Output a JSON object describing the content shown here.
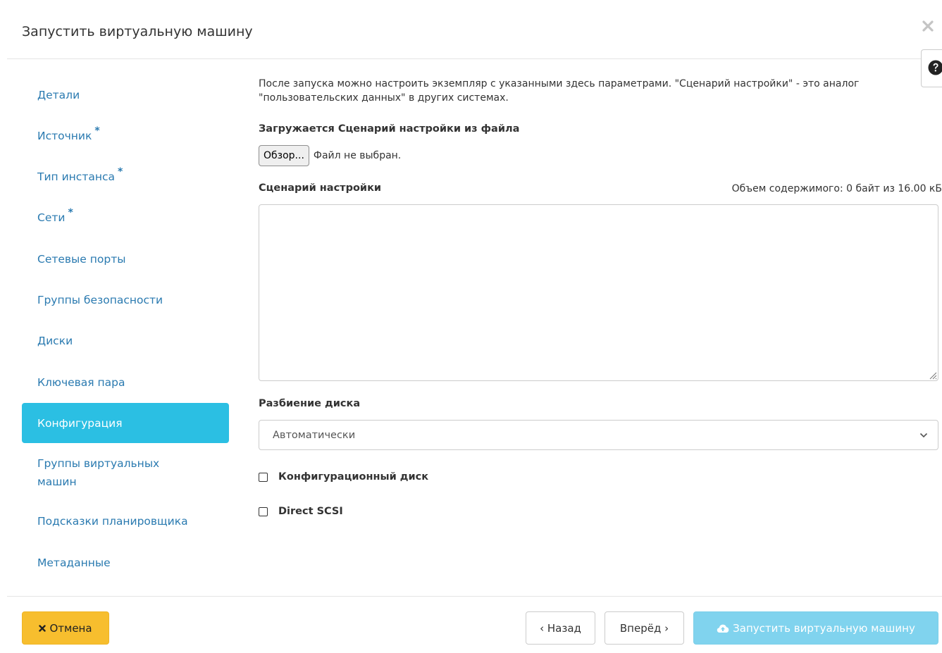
{
  "modal": {
    "title": "Запустить виртуальную машину",
    "close_icon": "close-icon",
    "help_icon": "question-circle-icon"
  },
  "nav": {
    "items": [
      {
        "label": "Детали",
        "required": false,
        "active": false
      },
      {
        "label": "Источник",
        "required": true,
        "active": false
      },
      {
        "label": "Тип инстанса",
        "required": true,
        "active": false
      },
      {
        "label": "Сети",
        "required": true,
        "active": false
      },
      {
        "label": "Сетевые порты",
        "required": false,
        "active": false
      },
      {
        "label": "Группы безопасности",
        "required": false,
        "active": false
      },
      {
        "label": "Диски",
        "required": false,
        "active": false
      },
      {
        "label": "Ключевая пара",
        "required": false,
        "active": false
      },
      {
        "label": "Конфигурация",
        "required": false,
        "active": true
      },
      {
        "label": "Группы виртуальных машин",
        "required": false,
        "active": false
      },
      {
        "label": "Подсказки планировщика",
        "required": false,
        "active": false
      },
      {
        "label": "Метаданные",
        "required": false,
        "active": false
      }
    ],
    "required_mark": "*"
  },
  "config": {
    "help_text": "После запуска можно настроить экземпляр с указанными здесь параметрами. \"Сценарий настройки\" - это аналог \"пользовательских данных\" в других системах.",
    "file_label": "Загружается Сценарий настройки из файла",
    "browse_button": "Обзор...",
    "file_status": "Файл не выбран.",
    "script_label": "Сценарий настройки",
    "size_info": "Объем содержимого: 0 байт из 16.00 кБ",
    "script_value": "",
    "disk_partition_label": "Разбиение диска",
    "disk_partition_value": "Автоматически",
    "config_drive_label": "Конфигурационный диск",
    "config_drive_checked": false,
    "direct_scsi_label": "Direct SCSI",
    "direct_scsi_checked": false
  },
  "footer": {
    "cancel": "Отмена",
    "back": "‹ Назад",
    "next": "Вперёд ›",
    "launch": "Запустить виртуальную машину"
  },
  "colors": {
    "accent": "#2bbfe3",
    "link": "#2a7ab0",
    "cancel": "#f7be2e",
    "launch_disabled": "#80d3ee"
  }
}
